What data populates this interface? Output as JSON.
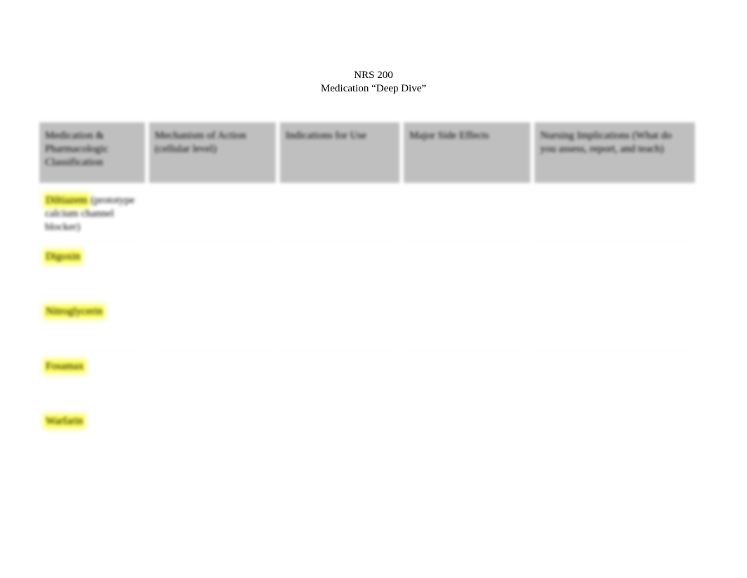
{
  "header": {
    "line1": "NRS 200",
    "line2": "Medication “Deep Dive”"
  },
  "columns": [
    "Medication & Pharmacologic Classification",
    "Mechanism of Action (cellular level)",
    "Indications for Use",
    "Major Side Effects",
    "Nursing Implications (What do you assess, report, and teach)"
  ],
  "rows": [
    {
      "med_highlight": "Diltiazem",
      "med_rest": " (prototype calcium channel blocker)",
      "mechanism": "",
      "indications": "",
      "side_effects": "",
      "nursing": ""
    },
    {
      "med_highlight": "Digoxin",
      "med_rest": "",
      "mechanism": "",
      "indications": "",
      "side_effects": "",
      "nursing": ""
    },
    {
      "med_highlight": "Nitroglycerin",
      "med_rest": "",
      "mechanism": "",
      "indications": "",
      "side_effects": "",
      "nursing": ""
    },
    {
      "med_highlight": "Fosamax",
      "med_rest": "",
      "mechanism": "",
      "indications": "",
      "side_effects": "",
      "nursing": ""
    },
    {
      "med_highlight": "Warfarin",
      "med_rest": "",
      "mechanism": "",
      "indications": "",
      "side_effects": "",
      "nursing": ""
    }
  ]
}
